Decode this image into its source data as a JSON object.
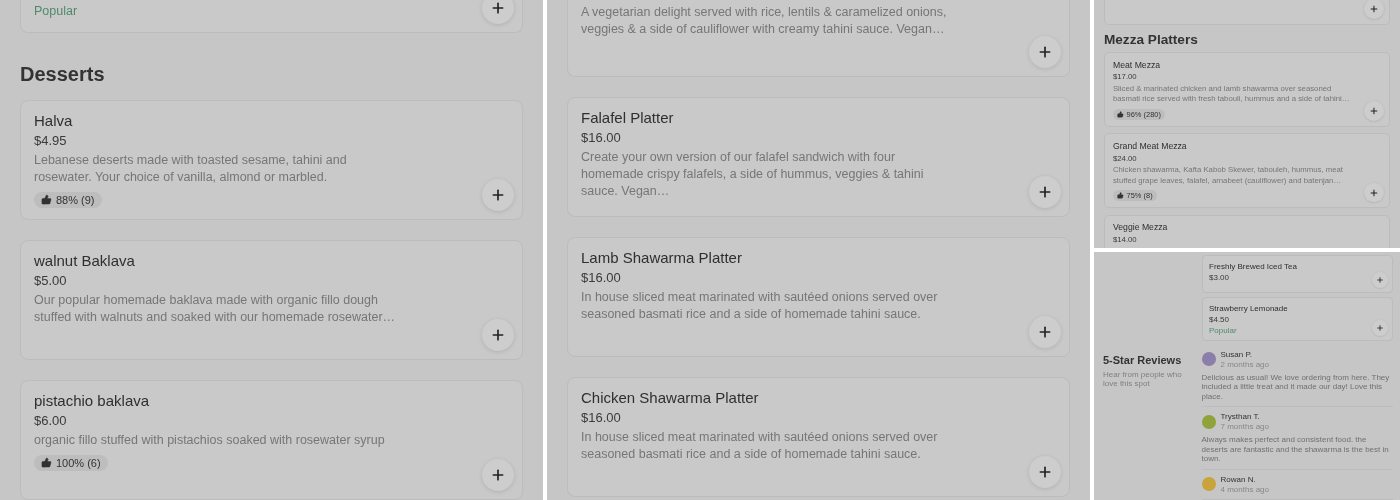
{
  "panels": [
    {
      "kind": "menu",
      "blocks": [
        {
          "kind": "card",
          "clipped": true,
          "badge": "Popular"
        },
        {
          "kind": "heading",
          "text": "Desserts"
        },
        {
          "kind": "card",
          "name": "Halva",
          "price": "$4.95",
          "description": "Lebanese deserts made with toasted sesame, tahini and rosewater. Your choice of vanilla, almond or marbled.",
          "rating": "88% (9)"
        },
        {
          "kind": "card",
          "name": "walnut Baklava",
          "price": "$5.00",
          "description": "Our popular homemade baklava made with organic fillo dough stuffed with walnuts and soaked with our homemade rosewater…"
        },
        {
          "kind": "card",
          "name": "pistachio baklava",
          "price": "$6.00",
          "description": "organic fillo stuffed with pistachios soaked with rosewater syrup",
          "rating": "100% (6)"
        }
      ]
    },
    {
      "kind": "menu",
      "blocks": [
        {
          "kind": "card",
          "clipped": true,
          "description": "A vegetarian delight served with rice, lentils & caramelized onions, veggies & a side of cauliflower with creamy tahini sauce. Vegan…"
        },
        {
          "kind": "card",
          "name": "Falafel Platter",
          "price": "$16.00",
          "description": "Create your own version of our falafel sandwich with four homemade crispy falafels, a side of hummus, veggies & tahini sauce. Vegan…"
        },
        {
          "kind": "card",
          "name": "Lamb Shawarma Platter",
          "price": "$16.00",
          "description": "In house sliced meat marinated with sautéed onions served over seasoned basmati rice and a side of homemade tahini sauce."
        },
        {
          "kind": "card",
          "name": "Chicken Shawarma Platter",
          "price": "$16.00",
          "description": "In house sliced meat marinated with sautéed onions served over seasoned basmati rice and a side of homemade tahini sauce."
        }
      ]
    },
    {
      "kind": "menu",
      "blocks": [
        {
          "kind": "card",
          "clipped": true
        },
        {
          "kind": "heading",
          "text": "Mezza Platters"
        },
        {
          "kind": "card",
          "name": "Meat Mezza",
          "price": "$17.00",
          "description": "Sliced & marinated chicken and lamb shawarma over seasoned basmati rice served with fresh tabouli, hummus and a side of tahini…",
          "rating": "96% (280)"
        },
        {
          "kind": "card",
          "name": "Grand Meat Mezza",
          "price": "$24.00",
          "description": "Chicken shawarma, Kafta Kabob Skewer, tabouleh, hummus, meat stuffed grape leaves, falafel, arnabeet (cauliflower) and batenjan…",
          "rating": "75% (8)"
        },
        {
          "kind": "card",
          "name": "Veggie Mezza",
          "price": "$14.00"
        }
      ]
    },
    {
      "kind": "reviews",
      "drinks": [
        {
          "name": "Freshly Brewed Iced Tea",
          "price": "$3.00"
        },
        {
          "name": "Strawberry Lemonade",
          "price": "$4.50",
          "badge": "Popular"
        }
      ],
      "title": "5-Star Reviews",
      "subtitle": "Hear from people who love this spot",
      "reviews": [
        {
          "name": "Susan P.",
          "time": "2 months ago",
          "text": "Delicious as usual! We love ordering from here. They included a little treat and it made our day! Love this place.",
          "color": "#8a7fa8"
        },
        {
          "name": "Trysthan T.",
          "time": "7 months ago",
          "text": "Always makes perfect and consistent food. the deserts are fantastic and the shawarma is the best in town.",
          "color": "#8fa33a"
        },
        {
          "name": "Rowan N.",
          "time": "4 months ago",
          "color": "#c9a43a"
        }
      ]
    }
  ]
}
